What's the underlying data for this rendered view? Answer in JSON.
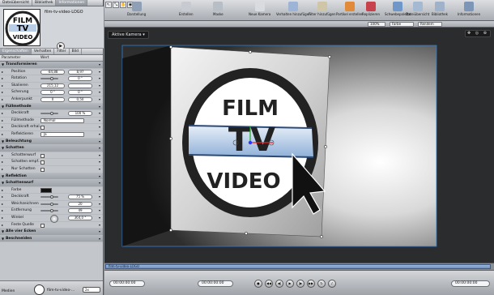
{
  "left_panel": {
    "top_tabs": [
      "Dateiübersicht",
      "Bibliothek",
      "Informationen"
    ],
    "preview_name": "film-tv-video-LOGO",
    "play_glyph": "▶",
    "sub_tabs": [
      "Eigenschaften",
      "Verhalten",
      "Filter",
      "Bild"
    ],
    "col_param": "Parameter",
    "col_value": "Wert",
    "rows": [
      {
        "kind": "sec",
        "label": "Transformieren"
      },
      {
        "kind": "pair",
        "label": "Position",
        "a": "-84,88",
        "b": "8,97"
      },
      {
        "kind": "single",
        "label": "Rotation",
        "a": "0 °"
      },
      {
        "kind": "pair",
        "label": "Skalieren",
        "a": "215,12",
        "b": ""
      },
      {
        "kind": "pair",
        "label": "Scherung",
        "a": "0 °",
        "b": "0 °"
      },
      {
        "kind": "pair",
        "label": "Ankerpunkt",
        "a": "0",
        "b": "0,50"
      },
      {
        "kind": "sec",
        "label": "Füllmethode"
      },
      {
        "kind": "single",
        "label": "Deckkraft",
        "a": "100 %"
      },
      {
        "kind": "menu",
        "label": "Füllmethode",
        "a": "Normal"
      },
      {
        "kind": "check",
        "label": "Deckkraft erhal..."
      },
      {
        "kind": "menu",
        "label": "Reflektieren",
        "a": "Ja"
      },
      {
        "kind": "sec",
        "label": "Beleuchtung"
      },
      {
        "kind": "sec",
        "label": "Schatten"
      },
      {
        "kind": "check",
        "label": "Schattenwurf"
      },
      {
        "kind": "check",
        "label": "Schatten empf..."
      },
      {
        "kind": "check",
        "label": "Nur Schatten"
      },
      {
        "kind": "sec",
        "label": "Reflektion"
      },
      {
        "kind": "sec",
        "label": "Schattenwurf"
      },
      {
        "kind": "color",
        "label": "Farbe"
      },
      {
        "kind": "single",
        "label": "Deckkraft",
        "a": "75 %"
      },
      {
        "kind": "single",
        "label": "Weichzeichnen",
        "a": "20"
      },
      {
        "kind": "single",
        "label": "Entfernung",
        "a": "49"
      },
      {
        "kind": "dial",
        "label": "Winkel",
        "a": "364,0 °"
      },
      {
        "kind": "check",
        "label": "Feste Quelle"
      },
      {
        "kind": "sec",
        "label": "Alle vier Ecken"
      },
      {
        "kind": "sec",
        "label": "Beschneiden"
      }
    ],
    "bottom_media": "Medien",
    "bottom_file": "film-tv-video-...",
    "bottom_select": "2x"
  },
  "toolbar": {
    "groups": [
      {
        "label": "Darstellung"
      },
      {
        "label": "Erstellen"
      },
      {
        "label": "Maske"
      },
      {
        "label": "Neue Kamera"
      },
      {
        "label": "Verhalten hinzufügen"
      },
      {
        "label": "Filter hinzufügen"
      },
      {
        "label": "Partikel erstellen"
      },
      {
        "label": "Replizieren"
      },
      {
        "label": "Schwebepalette"
      },
      {
        "label": "Dateiübersicht"
      },
      {
        "label": "Bibliothek"
      },
      {
        "label": "Informationen"
      }
    ]
  },
  "canvas_bar": {
    "zoom": "100%",
    "color": "Farbe",
    "render": "Rendern"
  },
  "canvas": {
    "camera_label": "Aktive Kamera ▾",
    "nav_glyphs": "✥ ◎ ⊕"
  },
  "logo": {
    "line1": "FILM",
    "line2": "TV",
    "line3": "VIDEO"
  },
  "timeline": {
    "track_label": "film-tv-video-LOGO"
  },
  "transport": {
    "timecode_left": "00:00:00:00",
    "timecode_right": "00:00:00:00",
    "timecode_end": "00:00:00:00"
  },
  "colors": {
    "accent": "#4d7fc0",
    "canvas_bg": "#2b2c2e",
    "panel": "#c3c6cb"
  }
}
